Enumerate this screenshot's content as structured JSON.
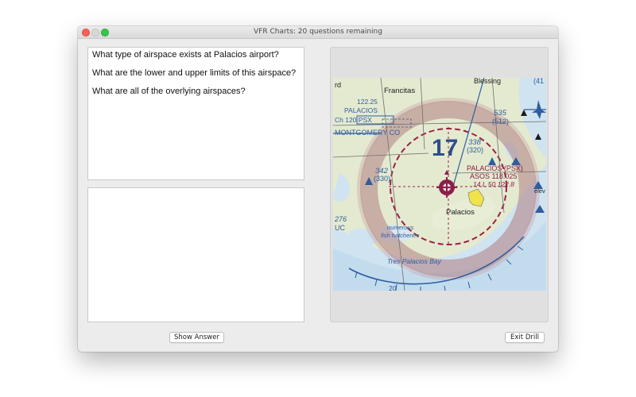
{
  "window": {
    "title": "VFR Charts:  20 questions remaining"
  },
  "questions": {
    "lines": [
      "What type of airspace exists at Palacios airport?",
      "What are the lower and upper limits of this airspace?",
      "What are all of the overlying airspaces?"
    ]
  },
  "answer": {
    "text": ""
  },
  "chart": {
    "labels": {
      "blessing": "Blessing",
      "francitas": "Francitas",
      "freq_12225": "122.25",
      "palacios_vor": "PALACIOS",
      "channel": "Ch 120 PSX",
      "montgomery": "MONTGOMERY CO",
      "alt_535": "535",
      "alt_512": "(512)",
      "alt_338": "338",
      "alt_320": "(320)",
      "alt_342": "342",
      "alt_330": "(330)",
      "mef": "17",
      "airport_name": "PALACIOS (PSX)",
      "asos": "ASOS 118.025",
      "airport_info": "14 L 50  122.8",
      "town": "Palacios",
      "numerous": "numerous",
      "fish": "fish hatcheries",
      "bay": "Tres Palacios Bay",
      "alt_276": "276",
      "uc": "UC",
      "partial_rd": "rd",
      "partial_41": "(41",
      "partial_elev": "elev",
      "partial_20": "20"
    }
  },
  "buttons": {
    "show_answer": "Show Answer",
    "exit_drill": "Exit Drill"
  }
}
